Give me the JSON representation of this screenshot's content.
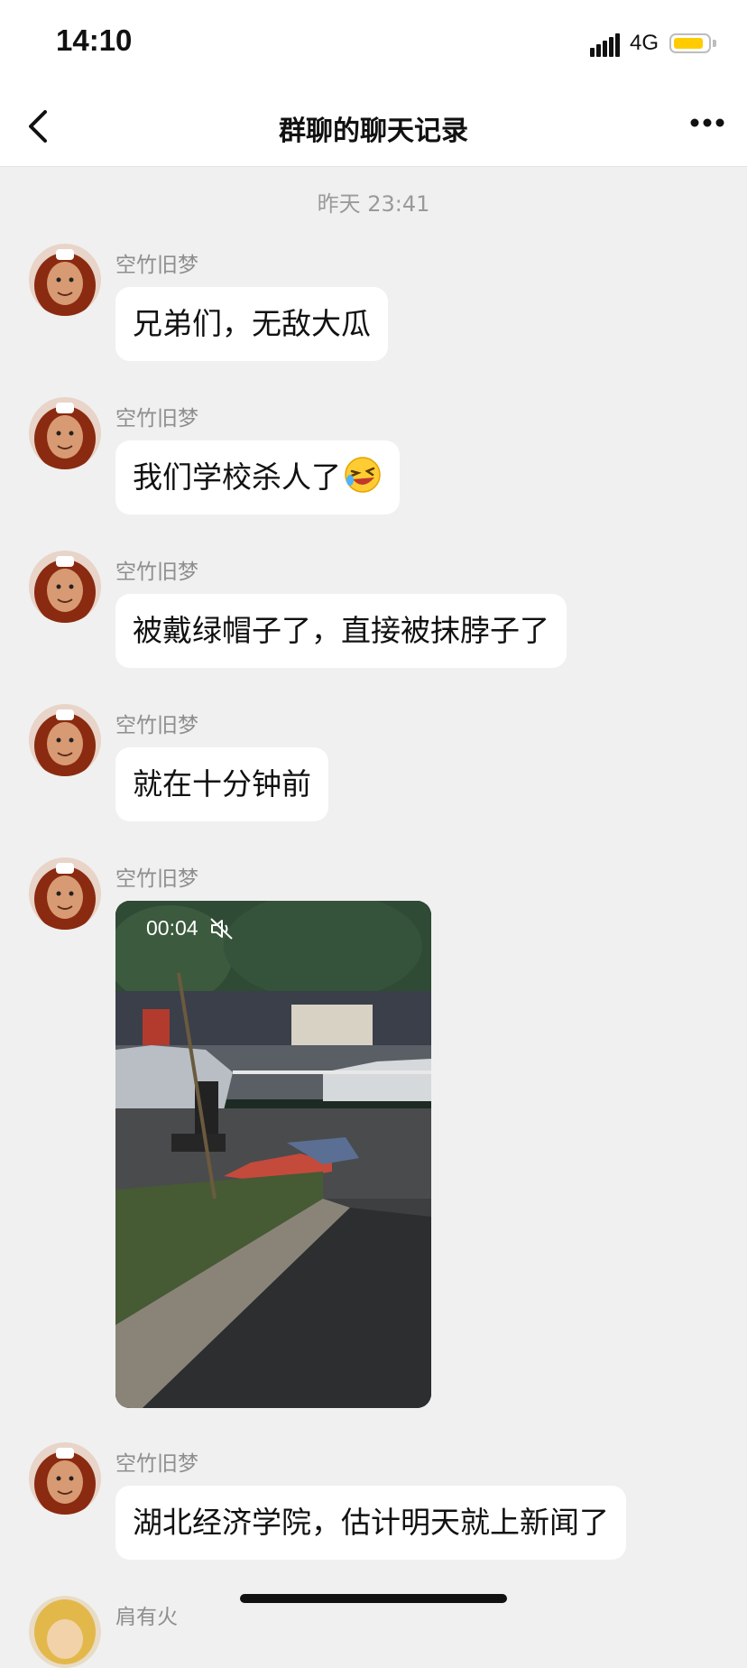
{
  "status_bar": {
    "time": "14:10",
    "network": "4G",
    "battery_level": 0.85,
    "battery_color": "#ffcc00"
  },
  "nav": {
    "title": "群聊的聊天记录",
    "back_icon": "chevron-left-icon",
    "more_icon": "more-dots-icon"
  },
  "timestamp": "昨天 23:41",
  "messages": [
    {
      "sender": "空竹旧梦",
      "text": "兄弟们，无敌大瓜"
    },
    {
      "sender": "空竹旧梦",
      "text": "我们学校杀人了",
      "emoji": "laughing-tears-emoji"
    },
    {
      "sender": "空竹旧梦",
      "text": "被戴绿帽子了，直接被抹脖子了"
    },
    {
      "sender": "空竹旧梦",
      "text": "就在十分钟前"
    },
    {
      "sender": "空竹旧梦",
      "video": {
        "duration": "00:04",
        "muted": true
      }
    },
    {
      "sender": "空竹旧梦",
      "text": "湖北经济学院，估计明天就上新闻了"
    },
    {
      "sender": "肩有火"
    }
  ],
  "colors": {
    "background": "#f0f0f0",
    "bubble": "#ffffff",
    "sender_text": "#8e8e8e"
  }
}
